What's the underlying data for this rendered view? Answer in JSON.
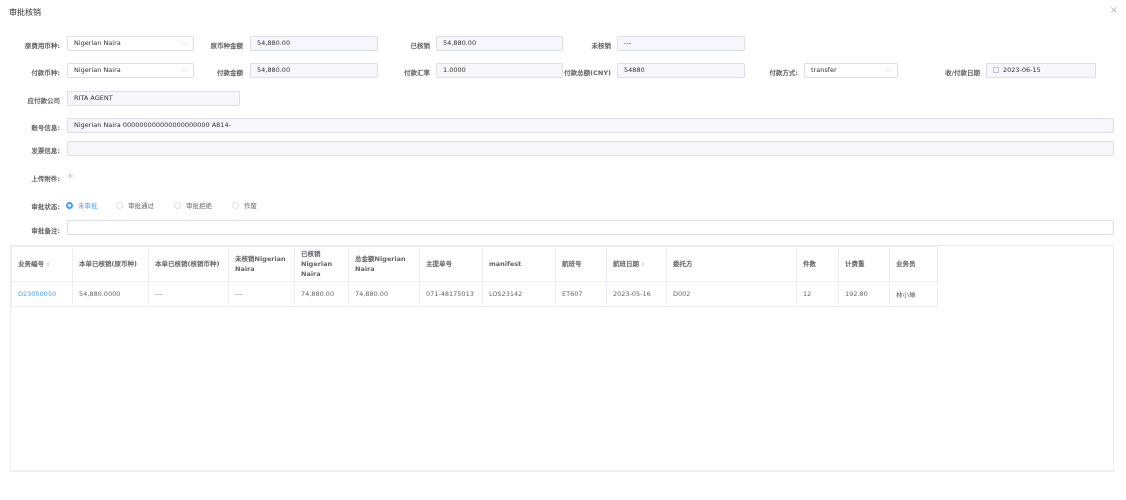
{
  "dialog": {
    "title": "审批核销",
    "close": "×"
  },
  "row1": {
    "orig_currency_label": "原费用币种:",
    "orig_currency_value": "Nigerian Naira",
    "orig_amount_label": "原币种金额",
    "orig_amount_value": "54,880.00",
    "written_off_label": "已核销",
    "written_off_value": "54,880.00",
    "unwritten_label": "未核销",
    "unwritten_value": "---"
  },
  "row2": {
    "pay_currency_label": "付款币种:",
    "pay_currency_value": "Nigerian Naira",
    "pay_amount_label": "付款金额",
    "pay_amount_value": "54,880.00",
    "rate_label": "付款汇率",
    "rate_value": "1.0000",
    "total_cny_label": "付款总额(CNY)",
    "total_cny_value": "54880",
    "method_label": "付款方式:",
    "method_value": "transfer",
    "date_label": "收/付款日期",
    "date_value": "2023-06-15"
  },
  "company": {
    "label": "应付款公司",
    "value": "RITA AGENT"
  },
  "account": {
    "label": "账号信息:",
    "value": "Nigerian Naira 000000000000000000000 A814-"
  },
  "invoice": {
    "label": "发票信息:",
    "value": ""
  },
  "attachment": {
    "label": "上传附件:",
    "plus": "+"
  },
  "status": {
    "label": "审批状态:",
    "options": [
      "未审批",
      "审批通过",
      "审批拒绝",
      "作废"
    ],
    "selected": "未审批"
  },
  "remark": {
    "label": "审批备注:",
    "value": ""
  },
  "table": {
    "headers": [
      "业务编号",
      "本单已核销(原币种)",
      "本单已核销(核销币种)",
      "未核销Nigerian Naira",
      "已核销Nigerian Naira",
      "总金额Nigerian Naira",
      "主提单号",
      "manifest",
      "航班号",
      "航班日期",
      "委托方",
      "件数",
      "计费重",
      "业务员"
    ],
    "sortable_cols": [
      0,
      9
    ],
    "rows": [
      [
        "D23050050",
        "54,880.0000",
        "---",
        "---",
        "74,880.00",
        "74,880.00",
        "071-48175013",
        "LOS23142",
        "ET607",
        "2023-05-16",
        "D002",
        "12",
        "192.80",
        "林小琳"
      ]
    ]
  },
  "icons": {
    "sort": "sort-icon",
    "chevron": "chevron-down-icon",
    "calendar": "calendar-icon",
    "plus": "plus-icon",
    "close": "close-icon"
  },
  "colors": {
    "accent": "#409eff",
    "border": "#dcdfe6",
    "field_bg": "#f5f7fa"
  }
}
